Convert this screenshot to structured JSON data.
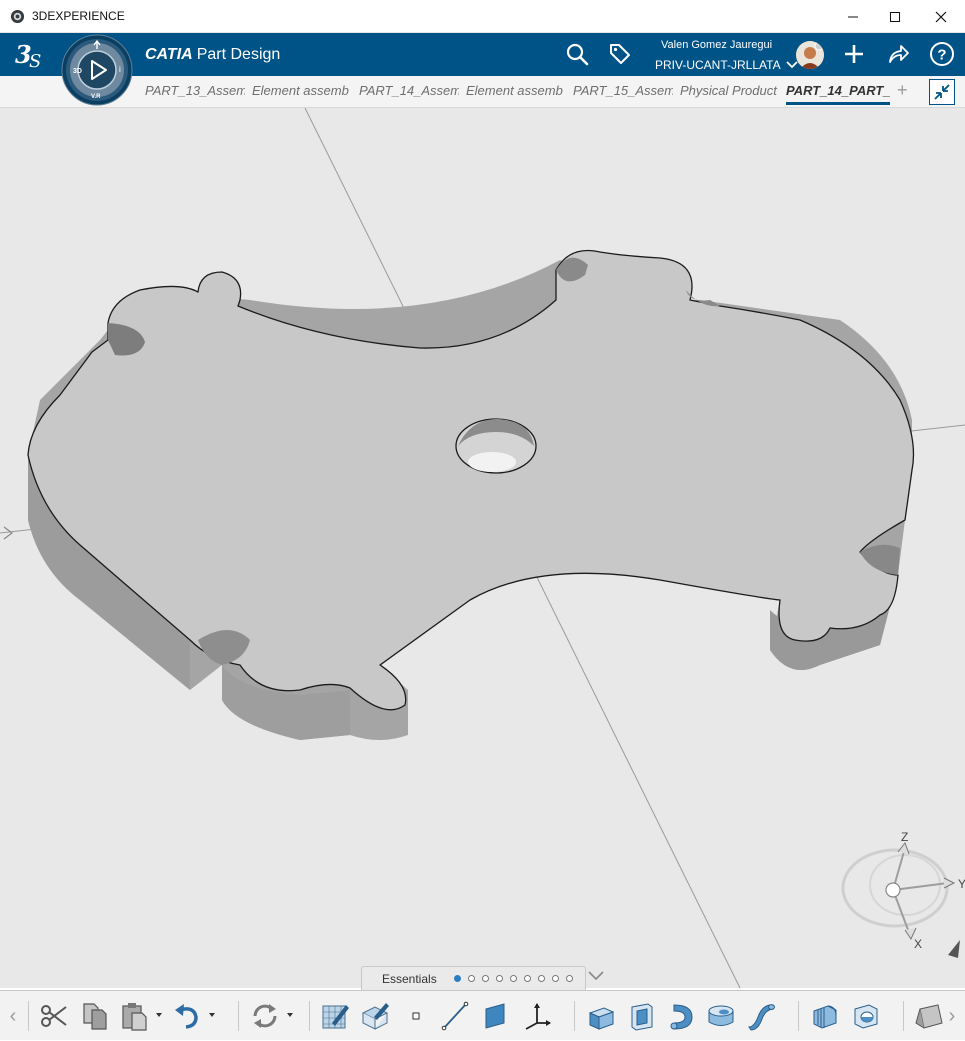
{
  "window": {
    "title": "3DEXPERIENCE",
    "minimize_icon": "minimize-icon",
    "maximize_icon": "maximize-icon",
    "close_icon": "close-icon"
  },
  "header": {
    "brand_strong": "CATIA",
    "brand_app": "Part Design",
    "user_name": "Valen Gomez Jauregui",
    "tenant": "PRIV-UCANT-JRLLATA",
    "accent": "#005386"
  },
  "compass": {
    "label_3d": "3D",
    "label_i": "i",
    "label_vr": "V.R"
  },
  "tabs": [
    {
      "label": "PART_13_Assem",
      "active": false
    },
    {
      "label": "Element assemb",
      "active": false
    },
    {
      "label": "PART_14_Assem",
      "active": false
    },
    {
      "label": "Element assemb",
      "active": false
    },
    {
      "label": "PART_15_Assem",
      "active": false
    },
    {
      "label": "Physical Product",
      "active": false
    },
    {
      "label": "PART_14_PART_",
      "active": true
    }
  ],
  "tab_add": "+",
  "viewport": {
    "background": "#e8e8e8",
    "part_color": "#c8c8c8",
    "triad": {
      "z": "Z",
      "x": "X",
      "y": "Y"
    }
  },
  "section_bar": {
    "label": "Essentials",
    "page_count": 9,
    "active_page": 1
  },
  "actionbar": {
    "tools": [
      "cut-icon",
      "copy-icon",
      "paste-icon",
      "undo-icon",
      "update-icon",
      "sketch-icon",
      "sketch-positioned-icon",
      "point-icon",
      "line-icon",
      "plane-icon",
      "axis-system-icon",
      "pad-icon",
      "pocket-icon",
      "shaft-icon",
      "hole-icon",
      "rib-icon",
      "fillet-icon",
      "shell-icon",
      "draft-icon"
    ]
  }
}
